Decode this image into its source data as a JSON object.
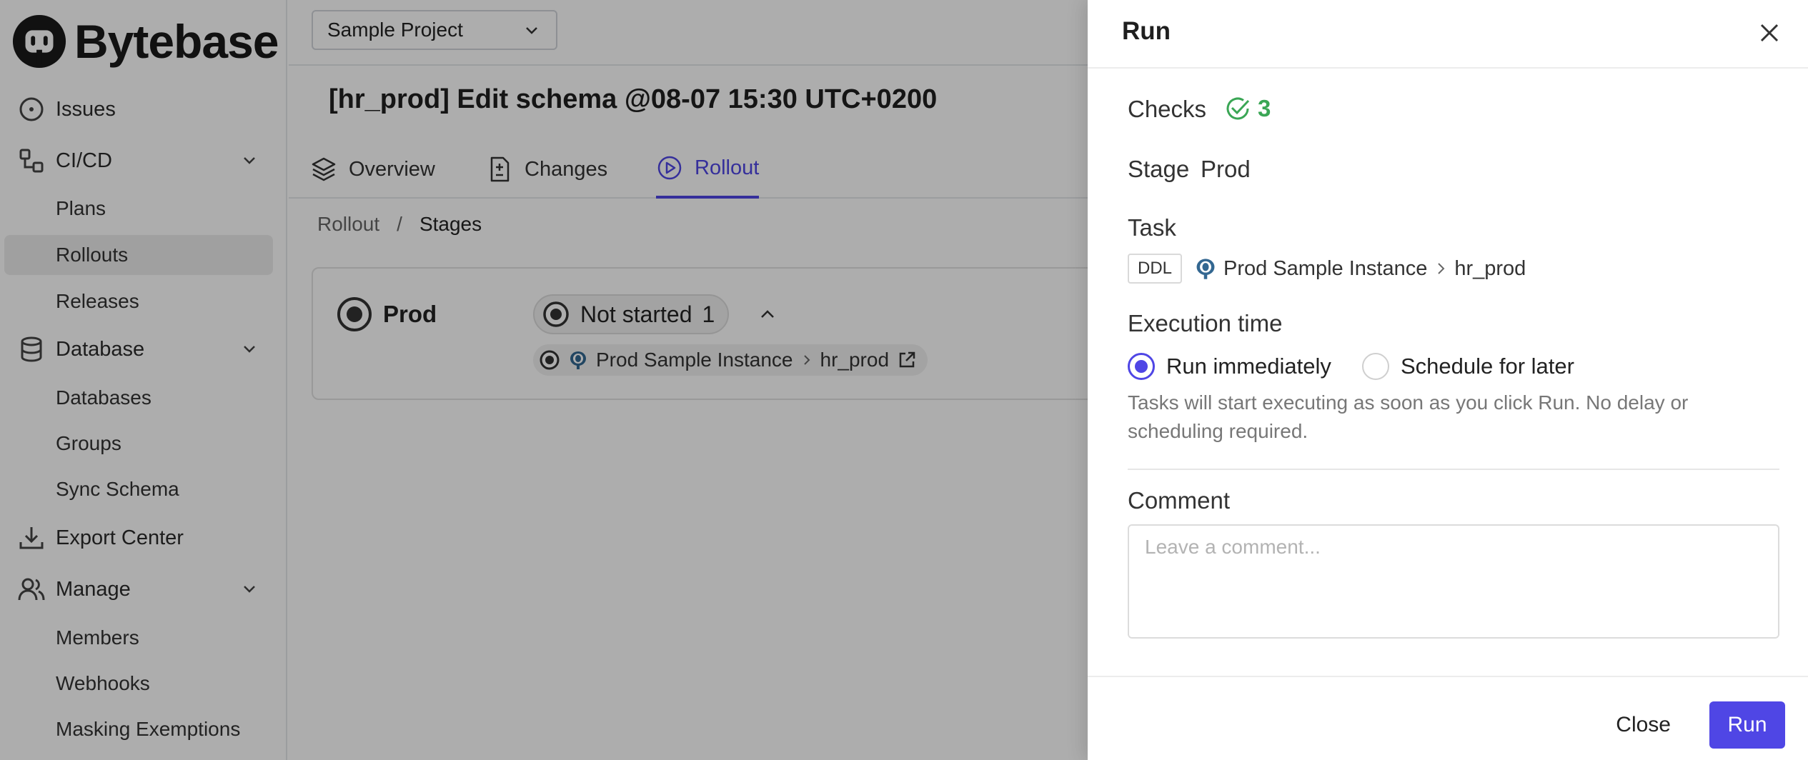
{
  "app": {
    "brand": "Bytebase"
  },
  "sidebar": {
    "items": [
      {
        "label": "Issues"
      },
      {
        "label": "CI/CD",
        "children": [
          "Plans",
          "Rollouts",
          "Releases"
        ]
      },
      {
        "label": "Database",
        "children": [
          "Databases",
          "Groups",
          "Sync Schema"
        ]
      },
      {
        "label": "Export Center"
      },
      {
        "label": "Manage",
        "children": [
          "Members",
          "Webhooks",
          "Masking Exemptions"
        ]
      }
    ],
    "active": "Rollouts"
  },
  "header": {
    "project": "Sample Project"
  },
  "issue": {
    "title": "[hr_prod] Edit schema @08-07 15:30 UTC+0200"
  },
  "tabs": [
    {
      "label": "Overview"
    },
    {
      "label": "Changes"
    },
    {
      "label": "Rollout",
      "active": true
    }
  ],
  "breadcrumb": {
    "parent": "Rollout",
    "separator": "/",
    "current": "Stages"
  },
  "stage_card": {
    "name": "Prod",
    "status": "Not started",
    "count": "1",
    "task_instance": "Prod Sample Instance",
    "task_db": "hr_prod"
  },
  "drawer": {
    "title": "Run",
    "checks_label": "Checks",
    "checks_count": "3",
    "stage_label": "Stage",
    "stage_value": "Prod",
    "task_label": "Task",
    "task_type": "DDL",
    "task_instance": "Prod Sample Instance",
    "task_db": "hr_prod",
    "exec_label": "Execution time",
    "run_now": "Run immediately",
    "schedule": "Schedule for later",
    "help": "Tasks will start executing as soon as you click Run. No delay or scheduling required.",
    "comment_label": "Comment",
    "comment_placeholder": "Leave a comment...",
    "close_btn": "Close",
    "run_btn": "Run"
  },
  "colors": {
    "accent": "#4f46e5",
    "success": "#3aa655",
    "overlay": "rgba(0,0,0,0.32)"
  }
}
